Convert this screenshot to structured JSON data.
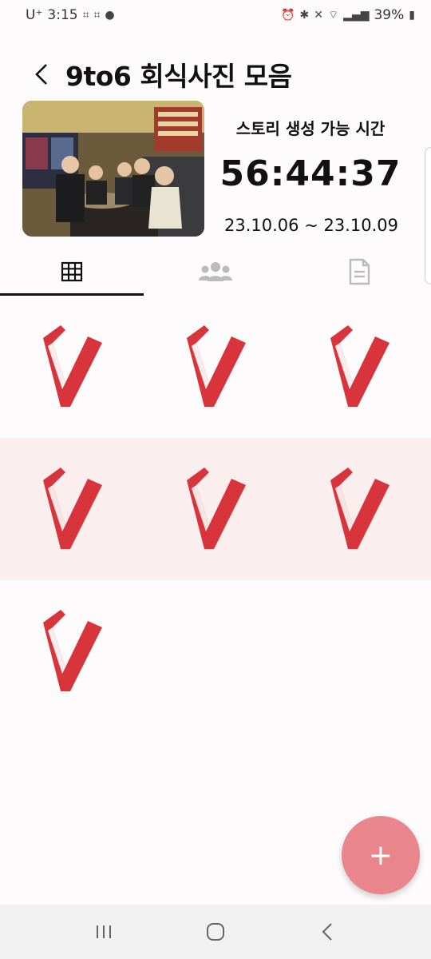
{
  "status_bar": {
    "carrier": "U⁺",
    "time": "3:15",
    "battery": "39%"
  },
  "header": {
    "title": "9to6 회식사진 모음"
  },
  "info": {
    "story_label": "스토리 생성 가능 시간",
    "countdown": "56:44:37",
    "date_range": "23.10.06 ~ 23.10.09"
  },
  "tabs": [
    {
      "name": "grid",
      "icon": "grid-icon",
      "active": true
    },
    {
      "name": "members",
      "icon": "group-icon",
      "active": false
    },
    {
      "name": "document",
      "icon": "document-icon",
      "active": false
    }
  ],
  "grid_items": 7,
  "fab": {
    "label": "+"
  },
  "colors": {
    "logo_red": "#d8343c",
    "highlight_row": "#fbeeee",
    "fab": "#e8868b"
  }
}
